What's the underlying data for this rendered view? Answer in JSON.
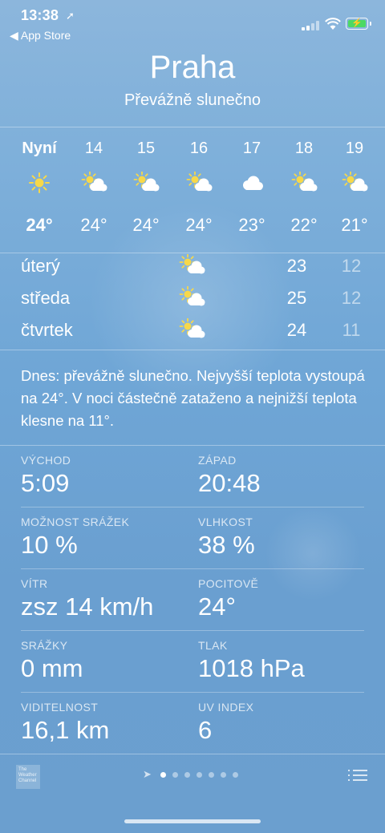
{
  "status_bar": {
    "time": "13:38",
    "back_label": "◀ App Store"
  },
  "header": {
    "city": "Praha",
    "condition": "Převážně slunečno"
  },
  "hourly": [
    {
      "hour": "Nyní",
      "temp": "24°",
      "icon": "sun-icon",
      "bold": true
    },
    {
      "hour": "14",
      "temp": "24°",
      "icon": "partly-cloudy-icon"
    },
    {
      "hour": "15",
      "temp": "24°",
      "icon": "partly-cloudy-icon"
    },
    {
      "hour": "16",
      "temp": "24°",
      "icon": "partly-cloudy-icon"
    },
    {
      "hour": "17",
      "temp": "23°",
      "icon": "cloud-icon"
    },
    {
      "hour": "18",
      "temp": "22°",
      "icon": "partly-cloudy-icon"
    },
    {
      "hour": "19",
      "temp": "21°",
      "icon": "partly-cloudy-icon"
    }
  ],
  "daily": [
    {
      "day": "úterý",
      "icon": "partly-cloudy-icon",
      "high": "23",
      "low": "12"
    },
    {
      "day": "středa",
      "icon": "partly-cloudy-icon",
      "high": "25",
      "low": "12"
    },
    {
      "day": "čtvrtek",
      "icon": "partly-cloudy-icon",
      "high": "24",
      "low": "11"
    }
  ],
  "summary": "Dnes: převážně slunečno. Nejvyšší teplota vystoupá na 24°. V noci částečně zataženo a nejnižší teplota klesne na 11°.",
  "details": [
    {
      "label": "VÝCHOD",
      "value": "5:09"
    },
    {
      "label": "ZÁPAD",
      "value": "20:48"
    },
    {
      "label": "MOŽNOST SRÁŽEK",
      "value": "10 %"
    },
    {
      "label": "VLHKOST",
      "value": "38 %"
    },
    {
      "label": "VÍTR",
      "value": "zsz 14 km/h"
    },
    {
      "label": "POCITOVĚ",
      "value": "24°"
    },
    {
      "label": "SRÁŽKY",
      "value": "0 mm"
    },
    {
      "label": "TLAK",
      "value": "1018 hPa"
    },
    {
      "label": "VIDITELNOST",
      "value": "16,1 km"
    },
    {
      "label": "UV INDEX",
      "value": "6"
    }
  ],
  "footer": {
    "logo_text": "The Weather Channel",
    "page_count": 7,
    "active_page": 0
  },
  "colors": {
    "sun": "#f7d84a",
    "battery": "#4cd964"
  }
}
